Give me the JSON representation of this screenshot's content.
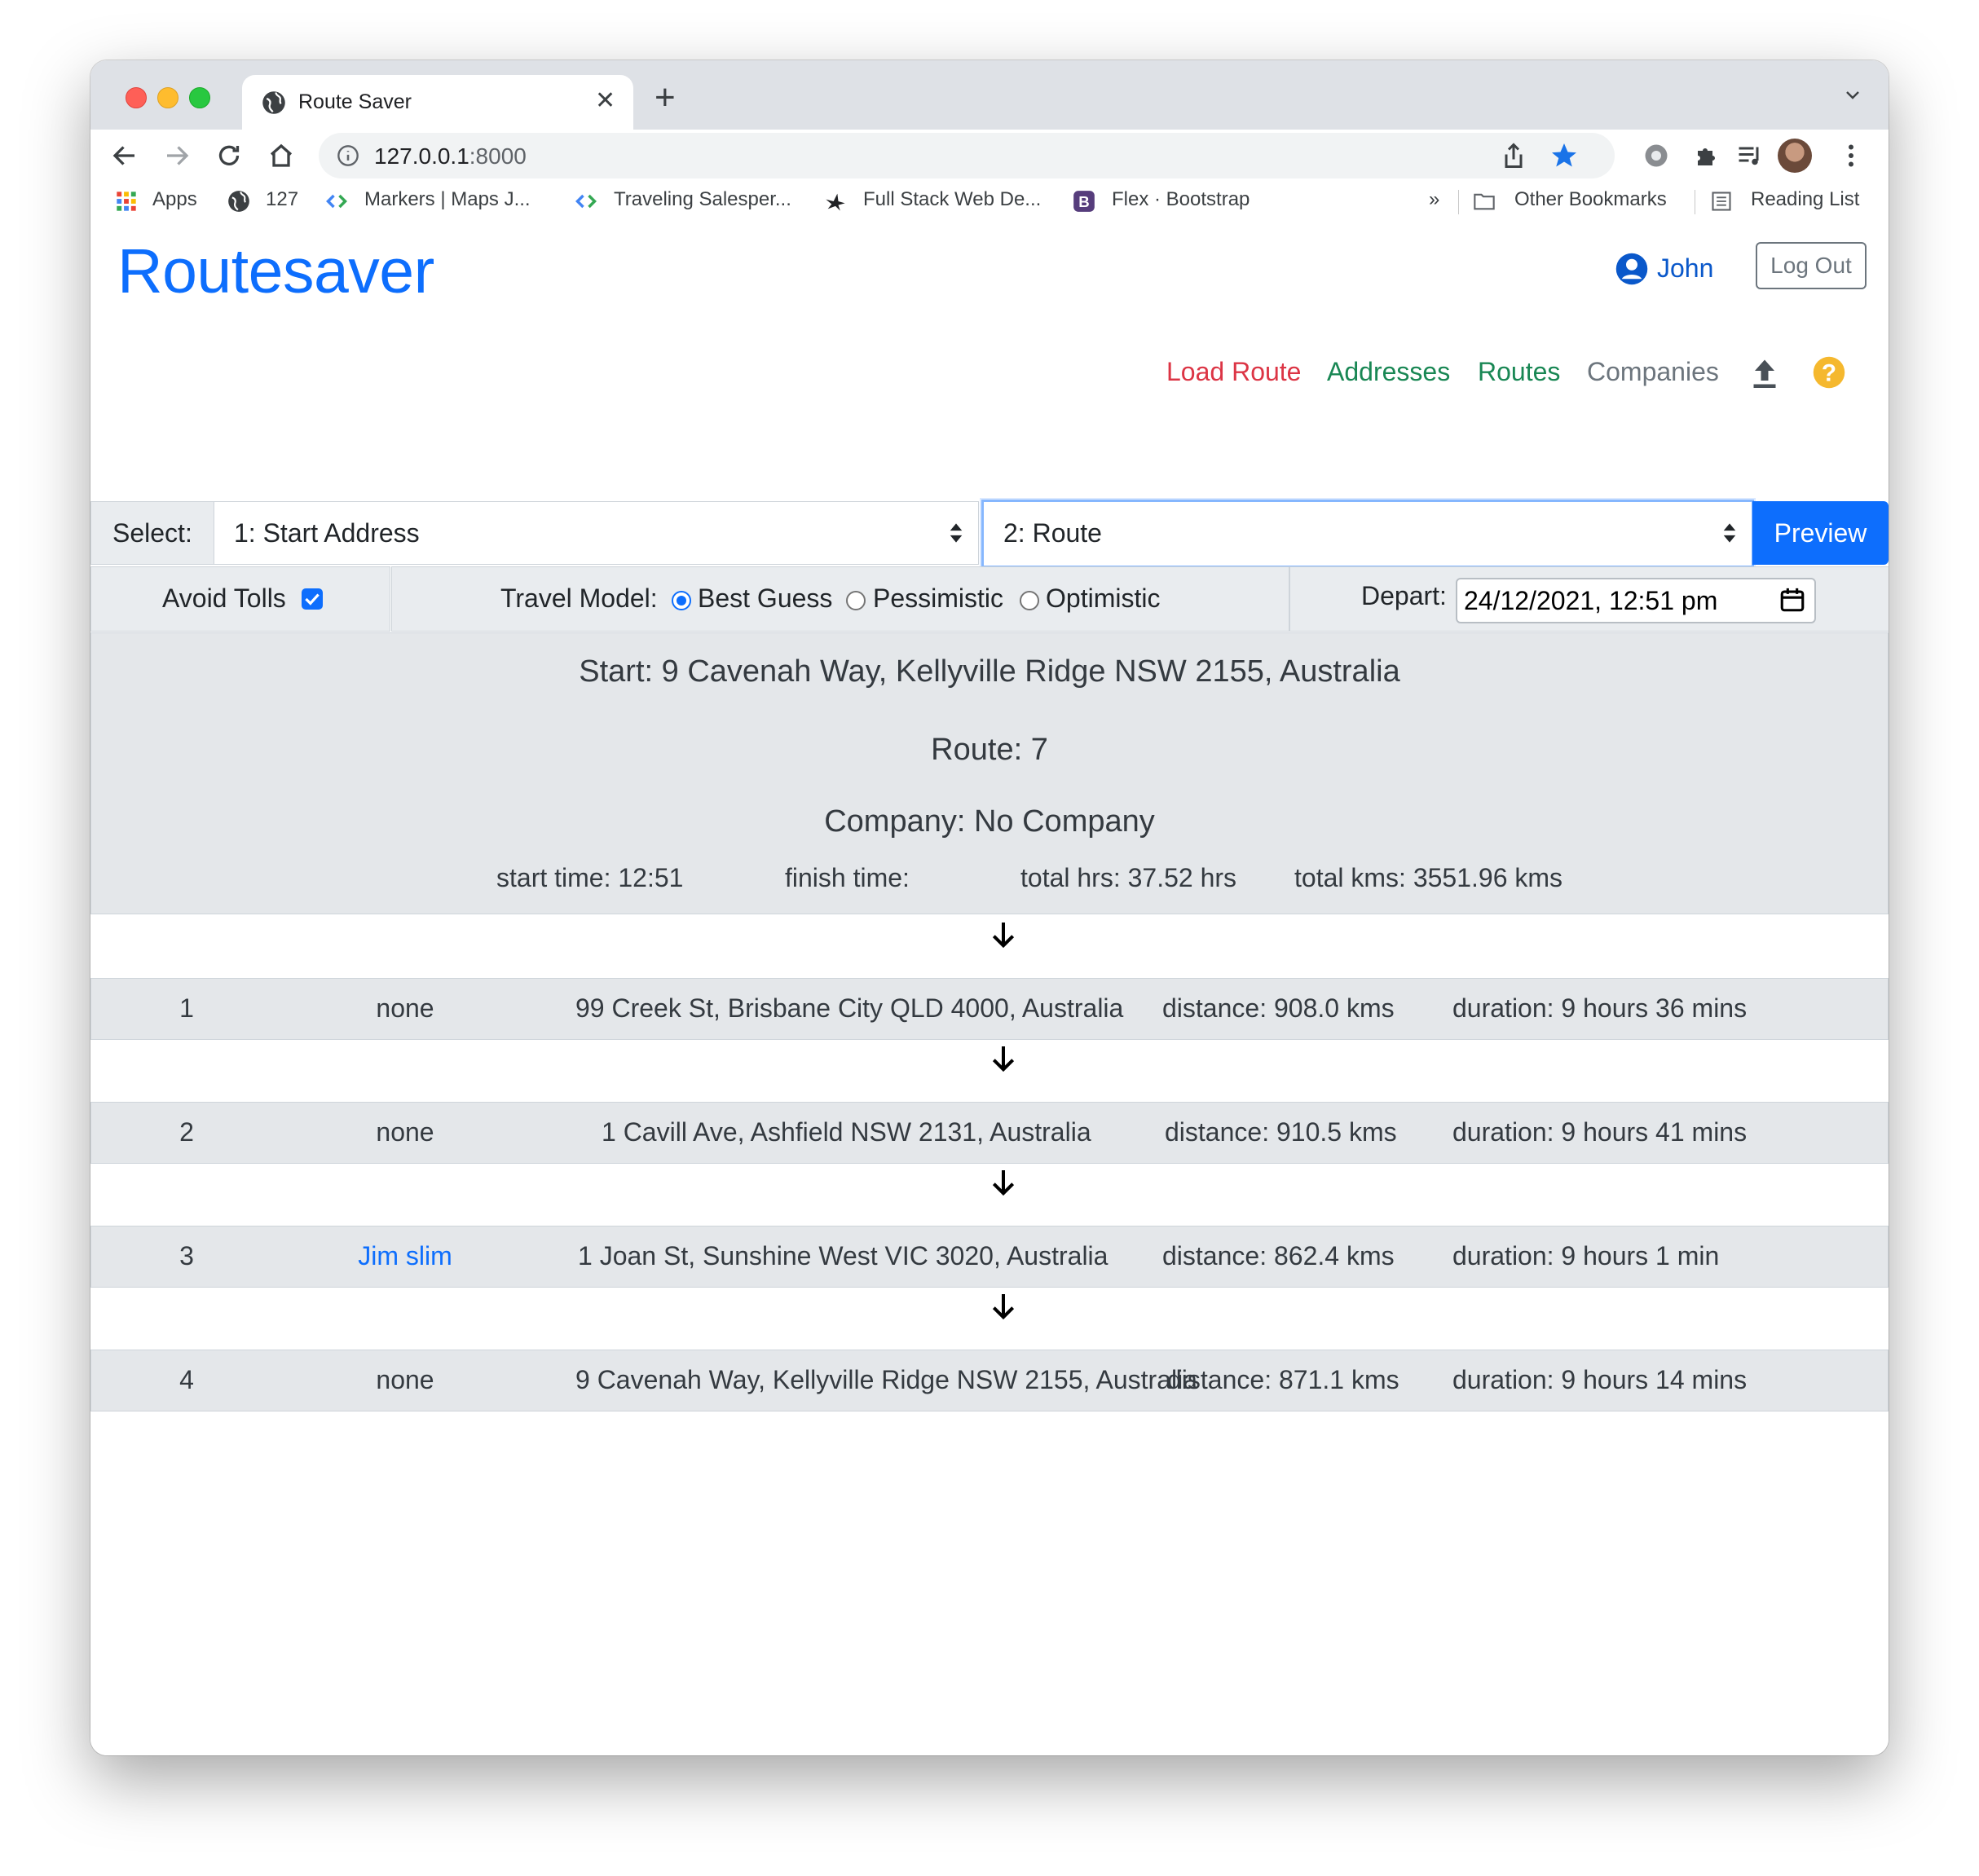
{
  "browser": {
    "tab_title": "Route Saver",
    "url_host": "127.0.0.1",
    "url_port": ":8000"
  },
  "bookmarks": {
    "apps": "Apps",
    "b127": "127",
    "markers": "Markers  |  Maps J...",
    "traveling": "Traveling Salesper...",
    "fullstack": "Full Stack Web De...",
    "flex": "Flex · Bootstrap",
    "more": "»",
    "other": "Other Bookmarks",
    "reading": "Reading List"
  },
  "header": {
    "brand": "Routesaver",
    "user": "John",
    "logout": "Log Out"
  },
  "nav": {
    "load_route": "Load Route",
    "addresses": "Addresses",
    "routes": "Routes",
    "companies": "Companies",
    "colors": {
      "load_route": "#dc3545",
      "addresses": "#198754",
      "routes": "#198754",
      "companies": "#6c757d"
    }
  },
  "selectors": {
    "label": "Select:",
    "start_address": "1: Start Address",
    "route": "2: Route",
    "preview": "Preview"
  },
  "options": {
    "avoid_tolls": "Avoid Tolls",
    "avoid_tolls_checked": true,
    "travel_model_label": "Travel Model:",
    "models": [
      "Best Guess",
      "Pessimistic",
      "Optimistic"
    ],
    "selected_model": "Best Guess",
    "depart_label": "Depart:",
    "depart_value": "24/12/2021, 12:51 pm"
  },
  "summary": {
    "start": "Start: 9 Cavenah Way, Kellyville Ridge NSW 2155, Australia",
    "route": "Route: 7",
    "company": "Company: No Company",
    "start_time": "start time: 12:51",
    "finish_time": "finish time:",
    "total_hrs": "total hrs: 37.52 hrs",
    "total_kms": "total kms: 3551.96 kms"
  },
  "stops": [
    {
      "num": "1",
      "contact": "none",
      "address": "99 Creek St, Brisbane City QLD 4000, Australia",
      "distance": "distance: 908.0 kms",
      "duration": "duration: 9 hours 36 mins"
    },
    {
      "num": "2",
      "contact": "none",
      "address": "1 Cavill Ave, Ashfield NSW 2131, Australia",
      "distance": "distance: 910.5 kms",
      "duration": "duration: 9 hours 41 mins"
    },
    {
      "num": "3",
      "contact": "Jim slim",
      "address": "1 Joan St, Sunshine West VIC 3020, Australia",
      "distance": "distance: 862.4 kms",
      "duration": "duration: 9 hours 1 min"
    },
    {
      "num": "4",
      "contact": "none",
      "address": "9 Cavenah Way, Kellyville Ridge NSW 2155, Australia",
      "distance": "distance: 871.1 kms",
      "duration": "duration: 9 hours 14 mins"
    }
  ]
}
